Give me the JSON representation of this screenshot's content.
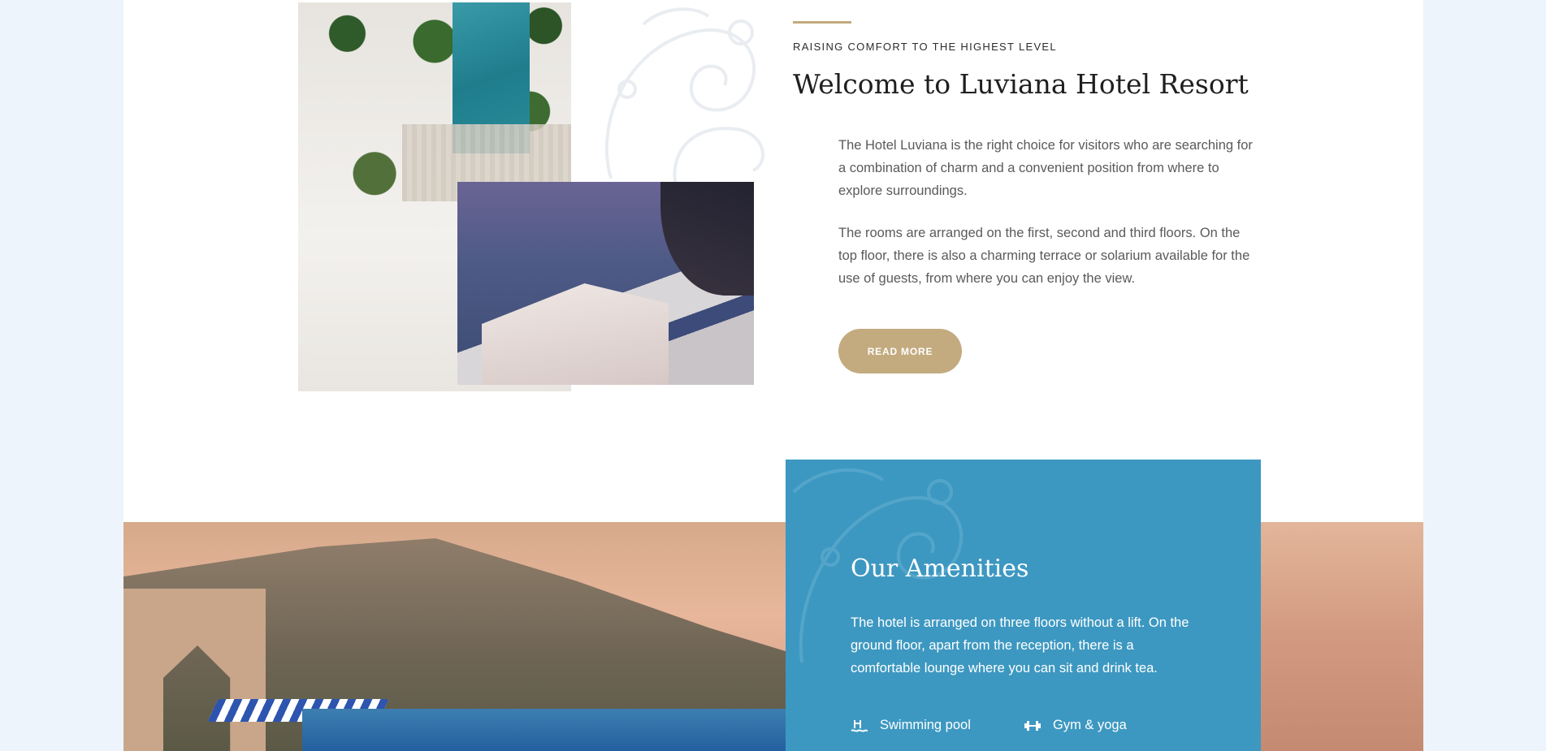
{
  "about": {
    "eyebrow": "RAISING COMFORT TO THE HIGHEST LEVEL",
    "title": "Welcome to Luviana Hotel Resort",
    "paragraphs": [
      "The Hotel Luviana is the right choice for visitors who are searching for a combination of charm and a convenient position from where to explore surroundings.",
      "The rooms are arranged on the first, second and third floors. On the top floor, there is also a charming terrace or solarium available for the use of guests, from where you can enjoy the view."
    ],
    "read_more_label": "READ MORE"
  },
  "amenities": {
    "title": "Our Amenities",
    "text": "The hotel is arranged on three floors without a lift. On the ground floor, apart from the reception, there is a comfortable lounge where you can sit and drink tea.",
    "items": [
      {
        "label": "Swimming pool",
        "icon": "swimming-pool-icon"
      },
      {
        "label": "Gym & yoga",
        "icon": "dumbbell-icon"
      }
    ]
  },
  "colors": {
    "page_background": "#edf4fb",
    "accent_gold": "#c3ab7f",
    "amenities_blue": "#3d98c1"
  }
}
